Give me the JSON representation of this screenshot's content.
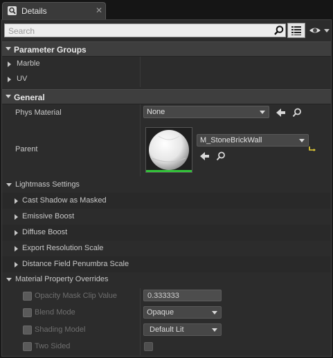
{
  "tab": {
    "title": "Details",
    "close": "✕"
  },
  "search": {
    "placeholder": "Search"
  },
  "icons": {
    "search": "search-icon",
    "list": "list-view-icon",
    "eye": "eye-icon",
    "reset": "reset-to-default-icon",
    "use": "arrow-left-icon",
    "browse": "magnifier-icon"
  },
  "colors": {
    "accent_green": "#33c43a",
    "reset_yellow": "#e9d136"
  },
  "parameter_groups": {
    "title": "Parameter Groups",
    "items": [
      "Marble",
      "UV"
    ]
  },
  "general": {
    "title": "General",
    "phys_material": {
      "label": "Phys Material",
      "value": "None"
    },
    "parent": {
      "label": "Parent",
      "value": "M_StoneBrickWall"
    },
    "lightmass": {
      "label": "Lightmass Settings",
      "items": [
        "Cast Shadow as Masked",
        "Emissive Boost",
        "Diffuse Boost",
        "Export Resolution Scale",
        "Distance Field Penumbra Scale"
      ]
    },
    "overrides": {
      "label": "Material Property Overrides",
      "opacity_mask": {
        "label": "Opacity Mask Clip Value",
        "value": "0.333333"
      },
      "blend_mode": {
        "label": "Blend Mode",
        "value": "Opaque"
      },
      "shading_model": {
        "label": "Shading Model",
        "value": "Default Lit"
      },
      "two_sided": {
        "label": "Two Sided"
      }
    }
  }
}
